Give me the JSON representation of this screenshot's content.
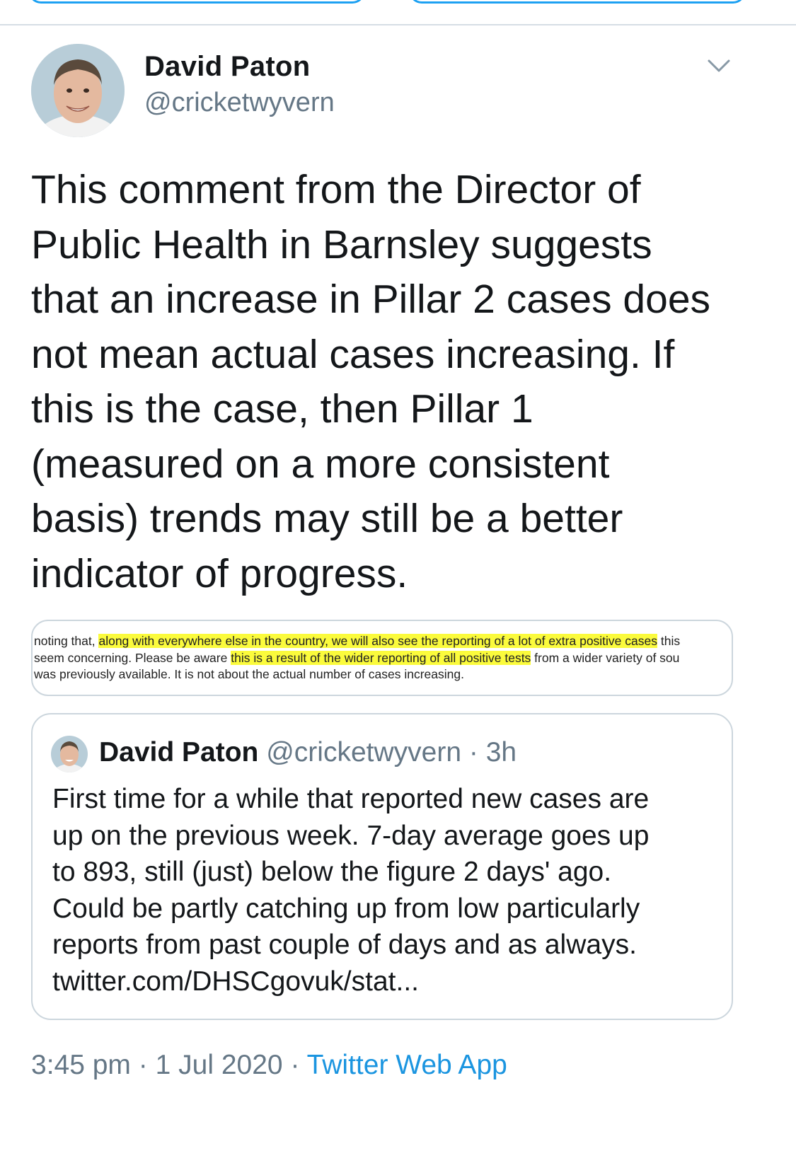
{
  "tweet": {
    "author_name": "David Paton",
    "author_handle": "@cricketwyvern",
    "text": "This comment from the Director of\nPublic Health in Barnsley suggests\nthat an increase in Pillar 2 cases does\nnot mean actual cases increasing. If\nthis is the case, then Pillar 1\n(measured on a more consistent\nbasis) trends may still be a better\nindicator of progress.",
    "time": "3:45 pm",
    "date": "1 Jul 2020",
    "separator": "·",
    "source": "Twitter Web App",
    "menu_icon": "chevron-down-icon"
  },
  "media": {
    "line1_pre": "noting that, ",
    "line1_highlight": "along with everywhere else in the country, we will also see the reporting of a lot of extra positive cases",
    "line1_post": " this",
    "line2_pre": "seem concerning. Please be aware ",
    "line2_highlight": "this is a result of the wider reporting of all positive tests",
    "line2_post": " from a wider variety of sou",
    "line3": "was previously available. It is not about the actual number of cases increasing.",
    "highlight_color": "#fbfb3c"
  },
  "quoted_tweet": {
    "author_name": "David Paton",
    "author_handle": "@cricketwyvern",
    "age": "· 3h",
    "text": "First time for a while that reported new cases are\nup on the previous week. 7-day average goes up\nto 893, still (just) below the figure 2 days' ago.\nCould be partly catching up from low particularly\nreports from past couple of days and as always.\ntwitter.com/DHSCgovuk/stat..."
  },
  "colors": {
    "text_primary": "#14171a",
    "text_secondary": "#657786",
    "link": "#1b95e0",
    "border": "#ccd6dd"
  }
}
